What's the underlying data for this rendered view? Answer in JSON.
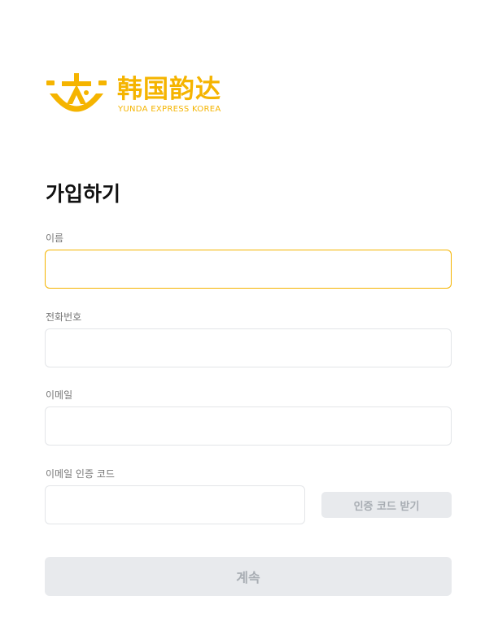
{
  "brand": {
    "name_cn": "韩国韵达",
    "name_en": "YUNDA EXPRESS KOREA",
    "color": "#f5b400",
    "logo_icon": "yunda-logo-icon"
  },
  "page": {
    "title": "가입하기"
  },
  "form": {
    "name": {
      "label": "이름",
      "value": "",
      "placeholder": ""
    },
    "phone": {
      "label": "전화번호",
      "value": "",
      "placeholder": ""
    },
    "email": {
      "label": "이메일",
      "value": "",
      "placeholder": ""
    },
    "email_code": {
      "label": "이메일 인증 코드",
      "value": "",
      "placeholder": ""
    },
    "get_code_label": "인증 코드 받기",
    "continue_label": "계속"
  },
  "colors": {
    "accent": "#f5b400",
    "disabled_bg": "#e8eaed",
    "disabled_text": "#a8adb3",
    "border": "#e3e5e8",
    "label": "#777777"
  }
}
